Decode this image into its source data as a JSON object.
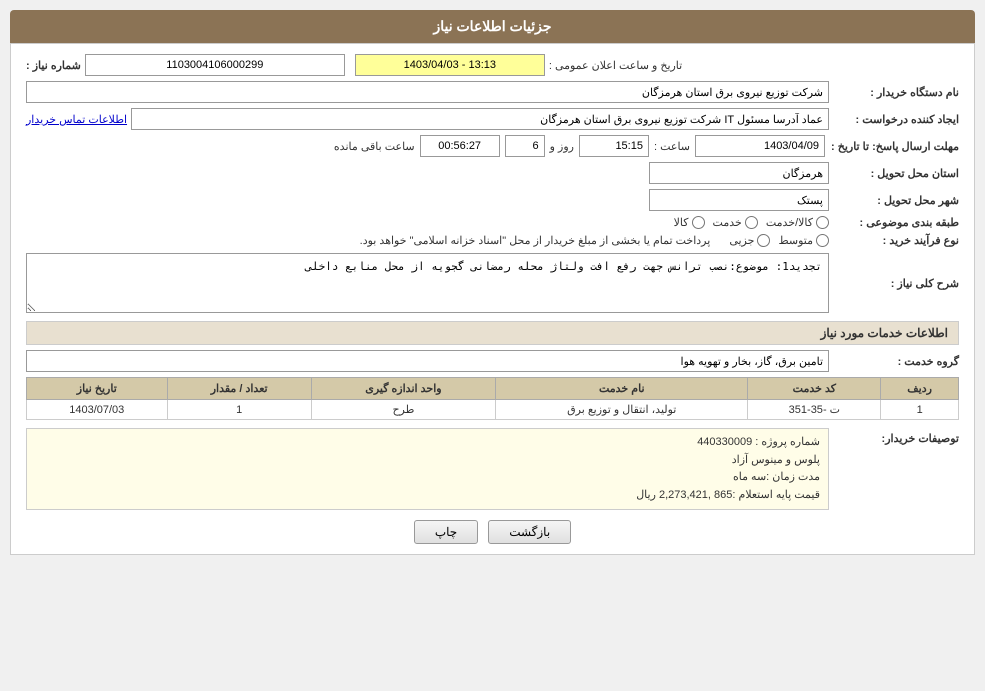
{
  "header": {
    "title": "جزئیات اطلاعات نیاز"
  },
  "fields": {
    "shomareNiaz_label": "شماره نیاز :",
    "shomareNiaz_value": "1103004106000299",
    "namDastgah_label": "نام دستگاه خریدار :",
    "namDastgah_value": "شرکت توزیع نیروی برق استان هرمزگان",
    "tarikh_label": "تاریخ و ساعت اعلان عمومی :",
    "tarikh_value": "1403/04/03 - 13:13",
    "ijadKonande_label": "ایجاد کننده درخواست :",
    "ijadKonande_value": "عماد آدرسا مسئول IT شرکت توزیع نیروی برق استان هرمزگان",
    "ettelaat_link": "اطلاعات تماس خریدار",
    "mohlatErsalPasokh_label": "مهلت ارسال پاسخ: تا تاریخ :",
    "date_value": "1403/04/09",
    "saaat_label": "ساعت :",
    "saat_value": "15:15",
    "roz_label": "روز و",
    "roz_value": "6",
    "saatBaghimande_label": "ساعت باقی مانده",
    "countdown_value": "00:56:27",
    "ostan_label": "استان محل تحویل :",
    "ostan_value": "هرمزگان",
    "shahr_label": "شهر محل تحویل :",
    "shahr_value": "پستک",
    "tabaghe_label": "طبقه بندی موضوعی :",
    "kala_label": "کالا",
    "khadamat_label": "خدمت",
    "kalaKhadamat_label": "کالا/خدمت",
    "noeFarayand_label": "نوع فرآیند خرید :",
    "jozyi_label": "جزیی",
    "motavasset_label": "متوسط",
    "pardakhtText": "پرداخت تمام یا بخشی از مبلغ خریدار از محل \"اسناد خزانه اسلامی\" خواهد بود.",
    "sharhSection_title": "شرح کلی نیاز :",
    "sharh_value": "تجدید1: موضوع:نصب ترانس جهت رفع افت ولتاژ محله رمضانی گجویه از محل منابع داخلی",
    "khadamatSection_title": "اطلاعات خدمات مورد نیاز",
    "groheKhadamat_label": "گروه خدمت :",
    "groheKhadamat_value": "تامین برق، گاز، بخار و تهویه هوا",
    "table": {
      "headers": [
        "ردیف",
        "کد خدمت",
        "نام خدمت",
        "واحد اندازه گیری",
        "تعداد / مقدار",
        "تاریخ نیاز"
      ],
      "rows": [
        {
          "radif": "1",
          "kodKhadamat": "ت -35-351",
          "namKhadamat": "تولید، انتقال و توزیع برق",
          "vahed": "طرح",
          "tedad": "1",
          "tarikh": "1403/07/03"
        }
      ]
    },
    "tosifatKharidar_label": "توصیفات خریدار:",
    "tosifat_line1": "شماره پروژه :  440330009",
    "tosifat_line2": "پلوس و مینوس آزاد",
    "tosifat_line3": "مدت زمان :سه ماه",
    "tosifat_line4": "قیمت پایه استعلام :865 ,2,273,421 ریال"
  },
  "buttons": {
    "back_label": "بازگشت",
    "print_label": "چاپ"
  }
}
